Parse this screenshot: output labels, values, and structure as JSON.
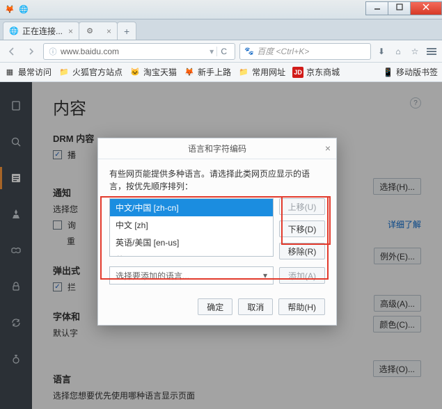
{
  "titlebar": {
    "icons": [
      "ff",
      "globe"
    ]
  },
  "tabs": [
    {
      "favicon": "globe",
      "label": "正在连接...",
      "closable": true
    },
    {
      "favicon": "gear",
      "label": "",
      "closable": true,
      "gear": true
    },
    {
      "new": true
    }
  ],
  "navbar": {
    "url": "www.baidu.com",
    "search_placeholder": "百度 <Ctrl+K>"
  },
  "bookmarks": [
    {
      "icon": "star",
      "label": "最常访问"
    },
    {
      "icon": "folder",
      "label": "火狐官方站点"
    },
    {
      "icon": "cat",
      "label": "淘宝天猫"
    },
    {
      "icon": "fox",
      "label": "新手上路"
    },
    {
      "icon": "folder",
      "label": "常用网址"
    },
    {
      "icon": "jd",
      "label": "京东商城"
    }
  ],
  "bookmarks_right": {
    "label": "移动版书签"
  },
  "sidebar": {
    "items": [
      {
        "name": "general",
        "glyph": "general"
      },
      {
        "name": "search",
        "glyph": "search"
      },
      {
        "name": "content",
        "glyph": "content",
        "active": true
      },
      {
        "name": "applications",
        "glyph": "app"
      },
      {
        "name": "privacy",
        "glyph": "mask"
      },
      {
        "name": "security",
        "glyph": "lock"
      },
      {
        "name": "sync",
        "glyph": "sync"
      },
      {
        "name": "advanced",
        "glyph": "adv"
      }
    ]
  },
  "page": {
    "title": "内容",
    "help": "?"
  },
  "sections": {
    "drm": {
      "heading": "DRM 内容",
      "checkbox_label": "播",
      "learn_more": "详细了解"
    },
    "notifications": {
      "heading": "通知",
      "row1_label": "选择您",
      "row1_btn": "选择(H)...",
      "row2_chk": false,
      "row2_label": "询",
      "row2_sub": "重"
    },
    "popups": {
      "heading": "弹出式",
      "chk_label": "拦",
      "btn": "例外(E)..."
    },
    "fonts": {
      "heading": "字体和",
      "row_label": "默认字",
      "btn1": "高级(A)...",
      "btn2": "颜色(C)..."
    },
    "language": {
      "heading": "语言",
      "row_label": "选择您想要优先使用哪种语言显示页面",
      "btn": "选择(O)..."
    }
  },
  "modal": {
    "title": "语言和字符编码",
    "desc": "有些网页能提供多种语言。请选择此类网页应显示的语言，按优先顺序排列：",
    "langs": [
      {
        "label": "中文/中国  [zh-cn]",
        "selected": true
      },
      {
        "label": "中文  [zh]"
      },
      {
        "label": "英语/美国  [en-us]"
      },
      {
        "label": "英语  [en]"
      }
    ],
    "btn_up": "上移(U)",
    "btn_down": "下移(D)",
    "btn_remove": "移除(R)",
    "dropdown_placeholder": "选择要添加的语言...",
    "btn_add": "添加(A)",
    "btn_ok": "确定",
    "btn_cancel": "取消",
    "btn_help": "帮助(H)"
  }
}
